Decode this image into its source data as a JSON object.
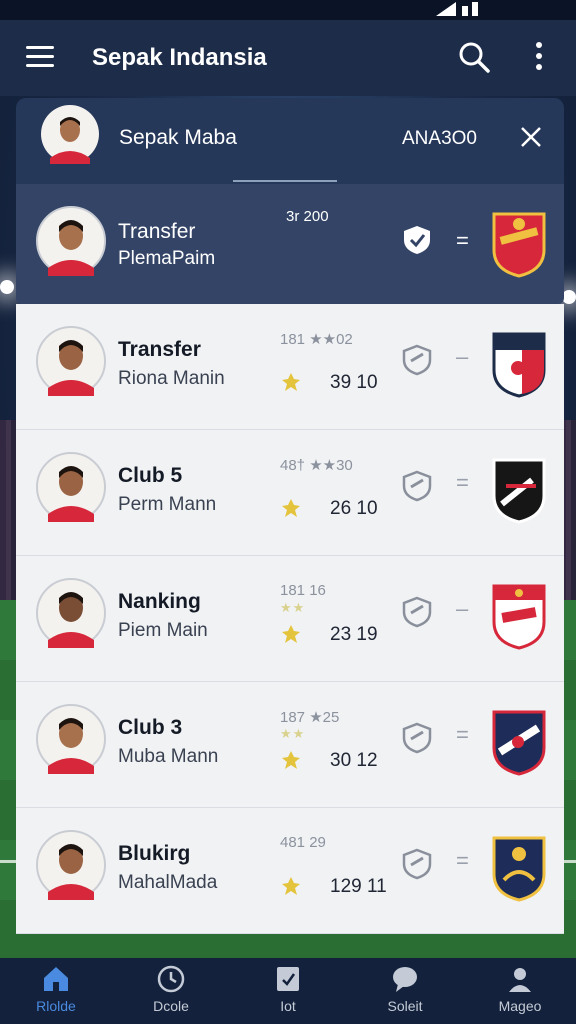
{
  "app_bar": {
    "title": "Sepak Indansia",
    "menu_icon": "menu-icon",
    "search_icon": "search-icon",
    "more_icon": "more-vertical-icon"
  },
  "detail": {
    "name": "Sepak Maba",
    "code": "ANA3O0",
    "close_icon": "close-icon"
  },
  "rows": [
    {
      "title": "Transfer",
      "subtitle": "PlemaPaim",
      "stat_top": "3r   200",
      "stars": "",
      "stat_value": "",
      "featured": true,
      "crest": "red"
    },
    {
      "title": "Transfer",
      "subtitle": "Riona Manin",
      "stat_top": "181 ★★02",
      "stars": "",
      "stat_value": "39 10",
      "crest": "red-white"
    },
    {
      "title": "Club 5",
      "subtitle": "Perm Mann",
      "stat_top": "48† ★★30",
      "stars": "",
      "stat_value": "26 10",
      "crest": "black"
    },
    {
      "title": "Nanking",
      "subtitle": "Piem Main",
      "stat_top": "181    16",
      "stars": "★★",
      "stat_value": "23 19",
      "crest": "red-white"
    },
    {
      "title": "Club 3",
      "subtitle": "Muba Mann",
      "stat_top": "187   ★25",
      "stars": "★★",
      "stat_value": "30 12",
      "crest": "navy"
    },
    {
      "title": "Blukirg",
      "subtitle": "MahalMada",
      "stat_top": "481    29",
      "stars": "",
      "stat_value": "129 11",
      "crest": "navy-gold"
    }
  ],
  "bottom_nav": [
    {
      "label": "Rlolde",
      "icon": "home-icon",
      "active": true
    },
    {
      "label": "Dcole",
      "icon": "clock-icon",
      "active": false
    },
    {
      "label": "Iot",
      "icon": "card-icon",
      "active": false
    },
    {
      "label": "Soleit",
      "icon": "chat-icon",
      "active": false
    },
    {
      "label": "Mageo",
      "icon": "profile-icon",
      "active": false
    }
  ],
  "colors": {
    "app_bar": "#1d2c48",
    "featured_row": "#334466",
    "accent": "#4a8ae0",
    "jersey_red": "#d6283a"
  }
}
